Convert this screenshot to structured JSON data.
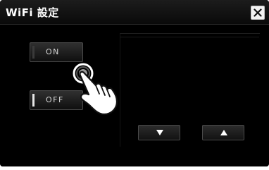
{
  "window": {
    "title": "WiFi 設定",
    "close_icon": "close-x-icon"
  },
  "options": [
    {
      "label": "ON",
      "selected": false
    },
    {
      "label": "OFF",
      "selected": true
    }
  ],
  "navigation": {
    "down_icon": "triangle-down-icon",
    "up_icon": "triangle-up-icon"
  },
  "overlay": {
    "icon": "tap-hand-cursor-icon"
  }
}
